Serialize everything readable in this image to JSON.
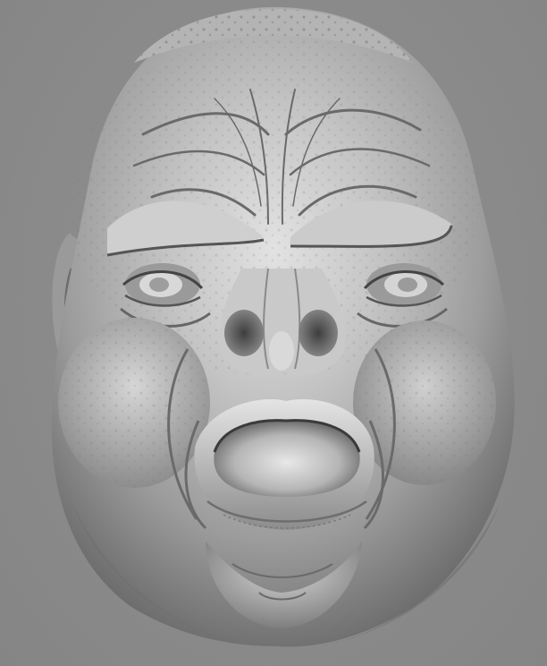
{
  "viewport": {
    "background_color": "#8a8a8a",
    "model_base_color": "#a9a9a9",
    "model_highlight_color": "#e6e6e6",
    "model_shadow_color": "#4a4a4a"
  },
  "model": {
    "subject": "sculpted-grimacing-head",
    "material": "grey-clay-matcap"
  }
}
